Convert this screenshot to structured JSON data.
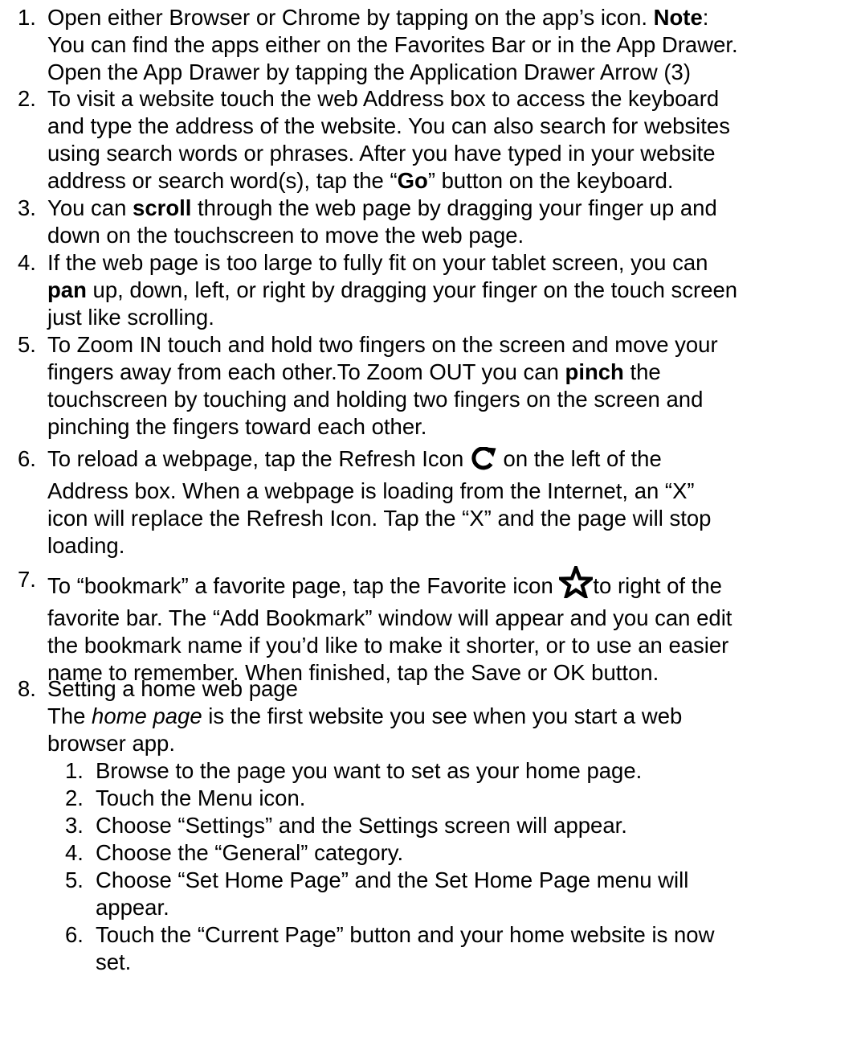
{
  "steps": [
    {
      "number": "1.",
      "lines": [
        {
          "a": "Open either Browser or Chrome by tapping on the app’s icon. ",
          "b": "Note",
          "c": ":"
        },
        {
          "a": "You can find the apps either on the Favorites Bar or in the App Drawer."
        },
        {
          "a": "Open the App Drawer by tapping the Application Drawer Arrow (3)"
        }
      ]
    },
    {
      "number": "2.",
      "lines": [
        {
          "a": "To visit a website touch the web Address box to access the keyboard"
        },
        {
          "a": "and type the address of the website. You can also search for websites"
        },
        {
          "a": "using search words or phrases. After you have typed in your website"
        },
        {
          "a": "address or search word(s), tap the “",
          "b": "Go",
          "c": "” button on the keyboard."
        }
      ]
    },
    {
      "number": "3.",
      "lines": [
        {
          "a": "You can ",
          "b": "scroll",
          "c": " through the web page by dragging your finger up and"
        },
        {
          "a": "down on the touchscreen to move the web page."
        }
      ]
    },
    {
      "number": "4.",
      "lines": [
        {
          "a": "If the web page is too large to fully fit on your tablet screen, you can"
        },
        {
          "b": "pan",
          "c": " up, down, left, or right by dragging your finger on the touch screen"
        },
        {
          "a": "just like scrolling."
        }
      ]
    },
    {
      "number": "5.",
      "lines": [
        {
          "a": "To Zoom IN touch and hold two fingers on the screen and move your"
        },
        {
          "a": "fingers away from each other.To Zoom OUT you can ",
          "b": "pinch",
          "c": " the"
        },
        {
          "a": "touchscreen by touching and holding two fingers on the screen and"
        },
        {
          "a": "pinching the fingers toward each other."
        }
      ]
    },
    {
      "number": "6.",
      "line1_before": "To reload a webpage, tap the Refresh Icon ",
      "line1_after": " on the left of the",
      "lines": [
        {
          "a": "Address box.  When a webpage is loading from the Internet, an “X”"
        },
        {
          "a": "icon will replace the Refresh Icon. Tap the “X” and the page will stop"
        },
        {
          "a": "loading."
        }
      ],
      "icon": "refresh-icon"
    },
    {
      "number": "7.",
      "line1_before": "To “bookmark” a favorite page, tap the Favorite icon ",
      "line1_after": "to right of the",
      "lines": [
        {
          "a": "favorite bar. The “Add Bookmark” window will appear and you can edit"
        },
        {
          "a": "the bookmark name if you’d like to make it shorter, or to use an easier"
        },
        {
          "a": "name to remember. When finished, tap the Save or OK button."
        }
      ],
      "icon": "star-icon"
    },
    {
      "number": "8.",
      "title": "Setting a home web page",
      "desc_before": "The ",
      "desc_italic": "home page",
      "desc_after": " is the first website you see when you start a web",
      "desc_line2": "browser app.",
      "substeps": [
        {
          "number": "1.",
          "lines": [
            "Browse to the page you want to set as your home page."
          ]
        },
        {
          "number": "2.",
          "lines": [
            "Touch the Menu icon."
          ]
        },
        {
          "number": "3.",
          "lines": [
            "Choose “Settings” and the Settings screen will appear."
          ]
        },
        {
          "number": "4.",
          "lines": [
            "Choose the “General” category."
          ]
        },
        {
          "number": "5.",
          "lines": [
            "Choose “Set Home Page” and the Set Home Page menu will",
            "appear."
          ]
        },
        {
          "number": "6.",
          "lines": [
            "Touch the “Current Page” button and your home website is now",
            "set."
          ]
        }
      ]
    }
  ]
}
